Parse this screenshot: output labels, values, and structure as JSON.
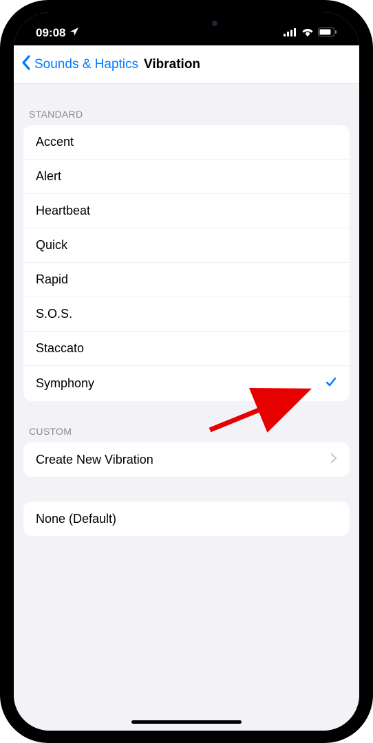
{
  "status": {
    "time": "09:08"
  },
  "nav": {
    "back_label": "Sounds & Haptics",
    "title": "Vibration"
  },
  "sections": {
    "standard": {
      "header": "STANDARD",
      "items": [
        {
          "label": "Accent",
          "selected": false
        },
        {
          "label": "Alert",
          "selected": false
        },
        {
          "label": "Heartbeat",
          "selected": false
        },
        {
          "label": "Quick",
          "selected": false
        },
        {
          "label": "Rapid",
          "selected": false
        },
        {
          "label": "S.O.S.",
          "selected": false
        },
        {
          "label": "Staccato",
          "selected": false
        },
        {
          "label": "Symphony",
          "selected": true
        }
      ]
    },
    "custom": {
      "header": "CUSTOM",
      "items": [
        {
          "label": "Create New Vibration",
          "disclosure": true
        }
      ]
    },
    "none": {
      "items": [
        {
          "label": "None (Default)"
        }
      ]
    }
  }
}
